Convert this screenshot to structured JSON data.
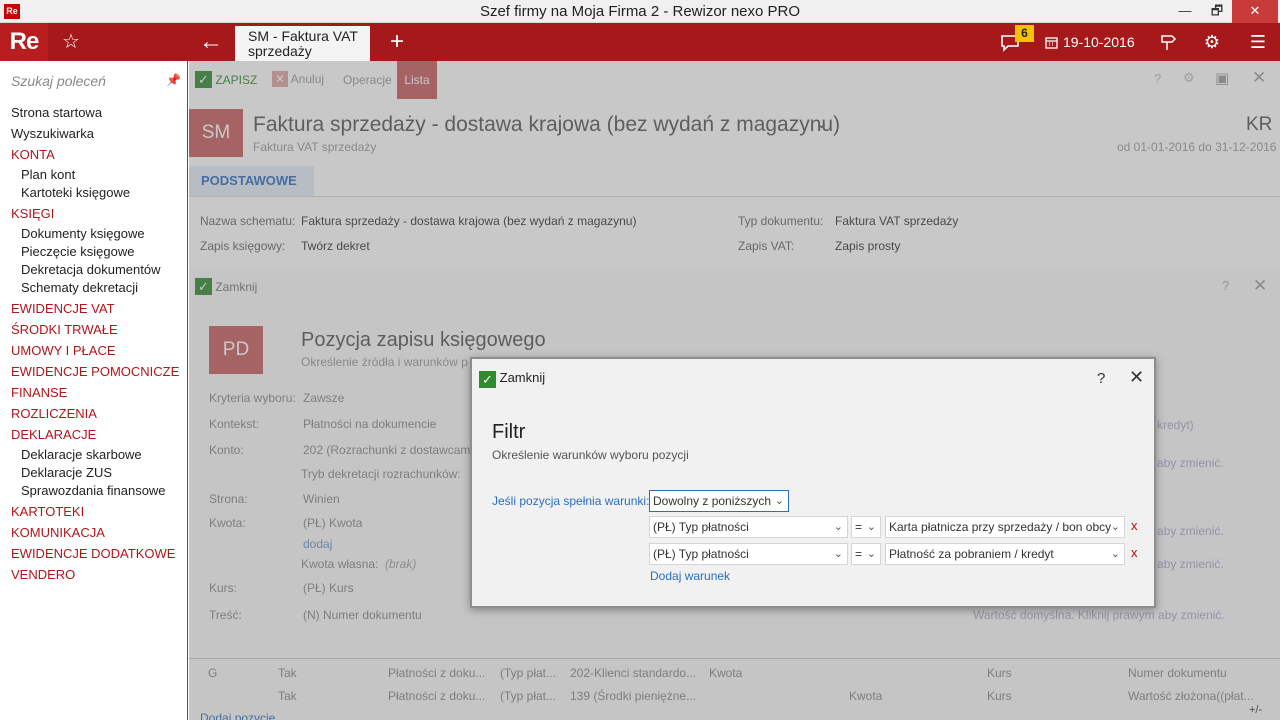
{
  "window": {
    "title": "Szef firmy na Moja Firma 2 - Rewizor nexo PRO",
    "logo": "Re",
    "min": "—",
    "max": "🗗",
    "close": "✕"
  },
  "topbar": {
    "logo": "Re",
    "tab_title": "SM - Faktura VAT sprzedaży",
    "notifications": "6",
    "date": "19-10-2016",
    "icons": [
      "star-icon",
      "back-arrow-icon",
      "plus-icon",
      "chat-icon",
      "calendar-icon",
      "signpost-icon",
      "gear-icon",
      "menu-icon"
    ],
    "brand_color": "#a6191b"
  },
  "sidebar": {
    "search_placeholder": "Szukaj poleceń",
    "items": [
      {
        "label": "Strona startowa",
        "level": 0,
        "red": false
      },
      {
        "label": "Wyszukiwarka",
        "level": 0,
        "red": false
      },
      {
        "label": "KONTA",
        "level": 0,
        "red": true
      },
      {
        "label": "Plan kont",
        "level": 1,
        "red": false
      },
      {
        "label": "Kartoteki księgowe",
        "level": 1,
        "red": false
      },
      {
        "label": "KSIĘGI",
        "level": 0,
        "red": true
      },
      {
        "label": "Dokumenty księgowe",
        "level": 1,
        "red": false
      },
      {
        "label": "Pieczęcie księgowe",
        "level": 1,
        "red": false
      },
      {
        "label": "Dekretacja dokumentów",
        "level": 1,
        "red": false
      },
      {
        "label": "Schematy dekretacji",
        "level": 1,
        "red": false
      },
      {
        "label": "EWIDENCJE VAT",
        "level": 0,
        "red": true
      },
      {
        "label": "ŚRODKI TRWAŁE",
        "level": 0,
        "red": true
      },
      {
        "label": "UMOWY I PŁACE",
        "level": 0,
        "red": true
      },
      {
        "label": "EWIDENCJE POMOCNICZE",
        "level": 0,
        "red": true
      },
      {
        "label": "FINANSE",
        "level": 0,
        "red": true
      },
      {
        "label": "ROZLICZENIA",
        "level": 0,
        "red": true
      },
      {
        "label": "DEKLARACJE",
        "level": 0,
        "red": true
      },
      {
        "label": "Deklaracje skarbowe",
        "level": 1,
        "red": false
      },
      {
        "label": "Deklaracje ZUS",
        "level": 1,
        "red": false
      },
      {
        "label": "Sprawozdania finansowe",
        "level": 1,
        "red": false
      },
      {
        "label": "KARTOTEKI",
        "level": 0,
        "red": true
      },
      {
        "label": "KOMUNIKACJA",
        "level": 0,
        "red": true
      },
      {
        "label": "EWIDENCJE DODATKOWE",
        "level": 0,
        "red": true
      },
      {
        "label": "VENDERO",
        "level": 0,
        "red": true
      }
    ]
  },
  "main": {
    "toolbar": {
      "save": "ZAPISZ",
      "cancel": "Anuluj",
      "ops": "Operacje",
      "list": "Lista"
    },
    "doc_badge": "SM",
    "doc_title": "Faktura sprzedaży - dostawa krajowa (bez wydań z magazynu)",
    "doc_subtitle": "Faktura VAT sprzedaży",
    "doc_code": "KR",
    "doc_period": "od 01-01-2016 do 31-12-2016",
    "tab_basic": "PODSTAWOWE",
    "fields": {
      "schema_label": "Nazwa schematu:",
      "schema_value": "Faktura sprzedaży - dostawa krajowa (bez wydań z magazynu)",
      "doc_type_label": "Typ dokumentu:",
      "doc_type_value": "Faktura VAT sprzedaży",
      "entry_label": "Zapis księgowy:",
      "entry_value": "Twórz dekret",
      "vat_label": "Zapis VAT:",
      "vat_value": "Zapis prosty"
    }
  },
  "panel2": {
    "close": "Zamknij",
    "badge": "PD",
    "title": "Pozycja zapisu księgowego",
    "subtitle": "Określenie źródła i warunków p",
    "rows": [
      {
        "label": "Kryteria wyboru:",
        "value": "Zawsze"
      },
      {
        "label": "Kontekst:",
        "value": "Płatności na dokumencie"
      },
      {
        "label": "Konto:",
        "value": "202 (Rozrachunki z dostawcami"
      },
      {
        "label": "",
        "value": "Tryb dekretacji rozrachunków:"
      },
      {
        "label": "Strona:",
        "value": "Winien"
      },
      {
        "label": "Kwota:",
        "value": "(PŁ) Kwota"
      },
      {
        "label": "",
        "value": "dodaj"
      },
      {
        "label": "",
        "value": "Kwota własna:"
      },
      {
        "label": "Kurs:",
        "value": "(PŁ) Kurs"
      },
      {
        "label": "Treść:",
        "value": "(N) Numer dokumentu"
      }
    ],
    "right_hints": [
      "kredyt)",
      "aby zmienić.",
      "aby zmienić.",
      "aby zmienić.",
      "Wartość domyślna. Kliknij prawym aby zmienić."
    ],
    "brak": "(brak)"
  },
  "table": {
    "rows": [
      [
        "G",
        "Tak",
        "Płatności z doku...",
        "(Typ płat...",
        "202-Klienci standardo...",
        "Kwota",
        "",
        "Kurs",
        "Numer dokumentu"
      ],
      [
        "",
        "Tak",
        "Płatności z doku...",
        "(Typ płat...",
        "139 (Środki pieniężne...",
        "",
        "Kwota",
        "Kurs",
        "Wartość złożona((płat..."
      ]
    ],
    "add": "Dodaj pozycję",
    "plusminus": "+/-"
  },
  "dialog": {
    "close": "Zamknij",
    "help": "?",
    "title": "Filtr",
    "subtitle": "Określenie warunków wyboru pozycji",
    "cond_label": "Jeśli pozycja spełnia warunki:",
    "cond_value": "Dowolny z poniższych",
    "rules": [
      {
        "field": "(PŁ) Typ płatności",
        "op": "=",
        "value": "Karta płatnicza przy sprzedaży / bon obcy",
        "remove": "x"
      },
      {
        "field": "(PŁ) Typ płatności",
        "op": "=",
        "value": "Płatność za pobraniem / kredyt",
        "remove": "x"
      }
    ],
    "add_condition": "Dodaj warunek"
  }
}
